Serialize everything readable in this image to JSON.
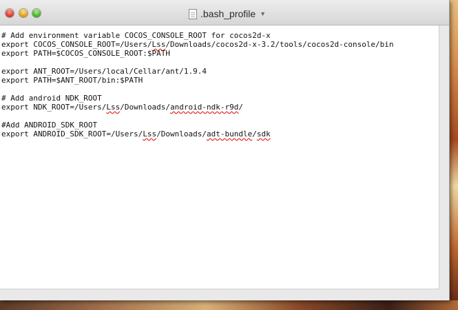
{
  "window": {
    "title": ".bash_profile",
    "title_menu_icon": "chevron-down-icon",
    "file_icon": "document-icon",
    "controls": [
      "close",
      "minimize",
      "zoom"
    ]
  },
  "editor": {
    "lines": [
      "# Add environment variable COCOS_CONSOLE_ROOT for cocos2d-x",
      "export COCOS_CONSOLE_ROOT=/Users/Lss/Downloads/cocos2d-x-3.2/tools/cocos2d-console/bin",
      "export PATH=$COCOS_CONSOLE_ROOT:$PATH",
      "",
      "export ANT_ROOT=/Users/local/Cellar/ant/1.9.4",
      "export PATH=$ANT_ROOT/bin:$PATH",
      "",
      "# Add android NDK_ROOT",
      "export NDK_ROOT=/Users/Lss/Downloads/android-ndk-r9d/",
      "",
      "#Add ANDROID_SDK_ROOT",
      "export ANDROID_SDK_ROOT=/Users/Lss/Downloads/adt-bundle/sdk"
    ],
    "misspelled_words": [
      "Lss",
      "android-ndk-r9d",
      "adt-bundle",
      "sdk"
    ]
  },
  "colors": {
    "spellcheck_underline": "#e02020",
    "close_button": "#e0443a",
    "minimize_button": "#e6a820",
    "zoom_button": "#4cb83a"
  }
}
